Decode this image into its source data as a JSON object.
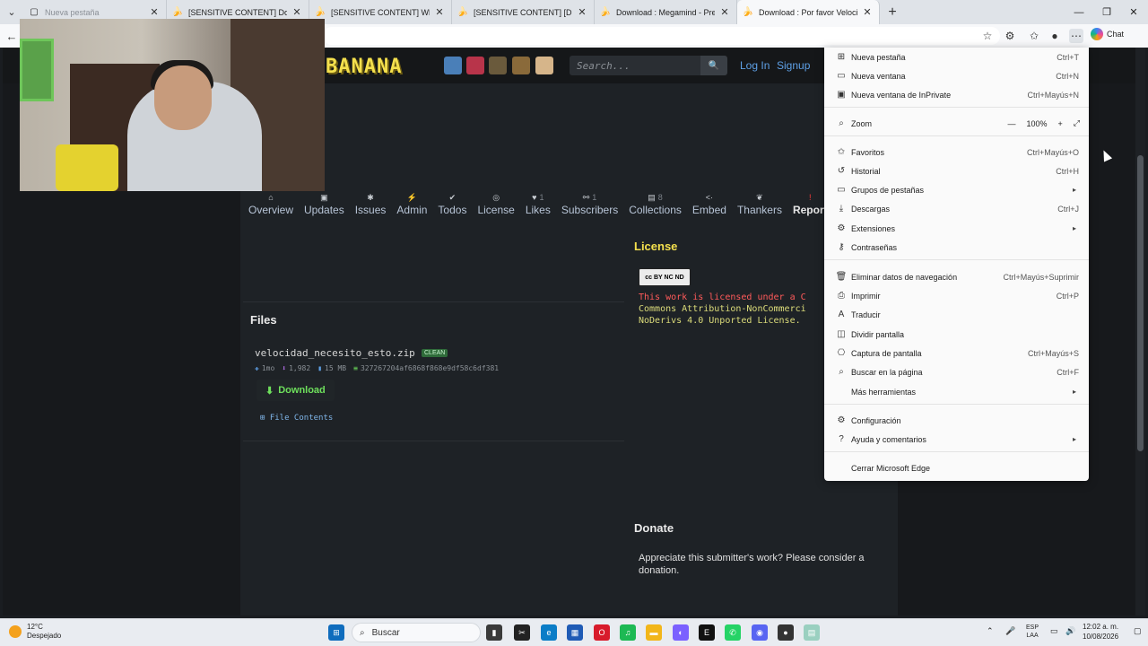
{
  "browser": {
    "tabs": [
      {
        "label": "Nueva pestaña",
        "state": "faded"
      },
      {
        "label": "[SENSITIVE CONTENT] Download",
        "state": "normal"
      },
      {
        "label": "[SENSITIVE CONTENT] Whiplash -",
        "state": "normal"
      },
      {
        "label": "[SENSITIVE CONTENT] [Dub Mode",
        "state": "normal"
      },
      {
        "label": "Download : Megamind - Presentat",
        "state": "normal"
      },
      {
        "label": "Download : Por favor Velocidad [D",
        "state": "active"
      }
    ],
    "new_tab": "+",
    "chat_label": "Chat"
  },
  "site": {
    "logo": "BANANA",
    "search_placeholder": "Search...",
    "login": "Log In",
    "signup": "Signup",
    "nav": [
      {
        "label": "Overview",
        "count": ""
      },
      {
        "label": "Updates",
        "count": ""
      },
      {
        "label": "Issues",
        "count": ""
      },
      {
        "label": "Admin",
        "count": ""
      },
      {
        "label": "Todos",
        "count": ""
      },
      {
        "label": "License",
        "count": ""
      },
      {
        "label": "Likes",
        "count": "1"
      },
      {
        "label": "Subscribers",
        "count": "1"
      },
      {
        "label": "Collections",
        "count": "8"
      },
      {
        "label": "Embed",
        "count": ""
      },
      {
        "label": "Thankers",
        "count": ""
      },
      {
        "label": "Report",
        "count": ""
      }
    ],
    "files": {
      "title": "Files",
      "filename": "velocidad_necesito_esto.zip",
      "badge": "CLEAN",
      "age": "1mo",
      "downloads": "1,982",
      "size": "15 MB",
      "hash": "327267204af6868f868e9df58c6df381",
      "download_label": "Download",
      "contents_label": "File Contents"
    },
    "license": {
      "title": "License",
      "badge": "cc BY NC ND",
      "text_red": "This work is licensed under a C",
      "text_yellow": "Commons Attribution-NonCommerci",
      "text_yellow2": "NoDerivs 4.0 Unported License."
    },
    "donate": {
      "title": "Donate",
      "text": "Appreciate this submitter's work? Please consider a donation."
    }
  },
  "menu": {
    "items": [
      {
        "label": "Nueva pestaña",
        "shortcut": "Ctrl+T",
        "icon": "new-tab-icon"
      },
      {
        "label": "Nueva ventana",
        "shortcut": "Ctrl+N",
        "icon": "window-icon"
      },
      {
        "label": "Nueva ventana de InPrivate",
        "shortcut": "Ctrl+Mayús+N",
        "icon": "inprivate-icon"
      },
      {
        "label": "Zoom",
        "shortcut": "",
        "icon": "zoom-icon"
      },
      {
        "label": "Favoritos",
        "shortcut": "Ctrl+Mayús+O",
        "icon": "favorites-icon"
      },
      {
        "label": "Historial",
        "shortcut": "Ctrl+H",
        "icon": "history-icon"
      },
      {
        "label": "Grupos de pestañas",
        "shortcut": "",
        "icon": "tab-groups-icon"
      },
      {
        "label": "Descargas",
        "shortcut": "Ctrl+J",
        "icon": "download-icon"
      },
      {
        "label": "Extensiones",
        "shortcut": "",
        "icon": "extensions-icon"
      },
      {
        "label": "Contraseñas",
        "shortcut": "",
        "icon": "key-icon"
      },
      {
        "label": "Eliminar datos de navegación",
        "shortcut": "Ctrl+Mayús+Suprimir",
        "icon": "trash-icon"
      },
      {
        "label": "Imprimir",
        "shortcut": "Ctrl+P",
        "icon": "print-icon"
      },
      {
        "label": "Traducir",
        "shortcut": "",
        "icon": "translate-icon"
      },
      {
        "label": "Dividir pantalla",
        "shortcut": "",
        "icon": "split-screen-icon"
      },
      {
        "label": "Captura de pantalla",
        "shortcut": "Ctrl+Mayús+S",
        "icon": "screenshot-icon"
      },
      {
        "label": "Buscar en la página",
        "shortcut": "Ctrl+F",
        "icon": "find-icon"
      },
      {
        "label": "Más herramientas",
        "shortcut": "",
        "icon": ""
      },
      {
        "label": "Configuración",
        "shortcut": "",
        "icon": "gear-icon"
      },
      {
        "label": "Ayuda y comentarios",
        "shortcut": "",
        "icon": "help-icon"
      },
      {
        "label": "Cerrar Microsoft Edge",
        "shortcut": "",
        "icon": ""
      }
    ],
    "zoom_value": "100%"
  },
  "taskbar": {
    "temp": "12°C",
    "condition": "Despejado",
    "search": "Buscar",
    "lang": "ESP",
    "lang2": "LAA",
    "time": "12:02 a. m.",
    "date": "10/08/2026"
  }
}
